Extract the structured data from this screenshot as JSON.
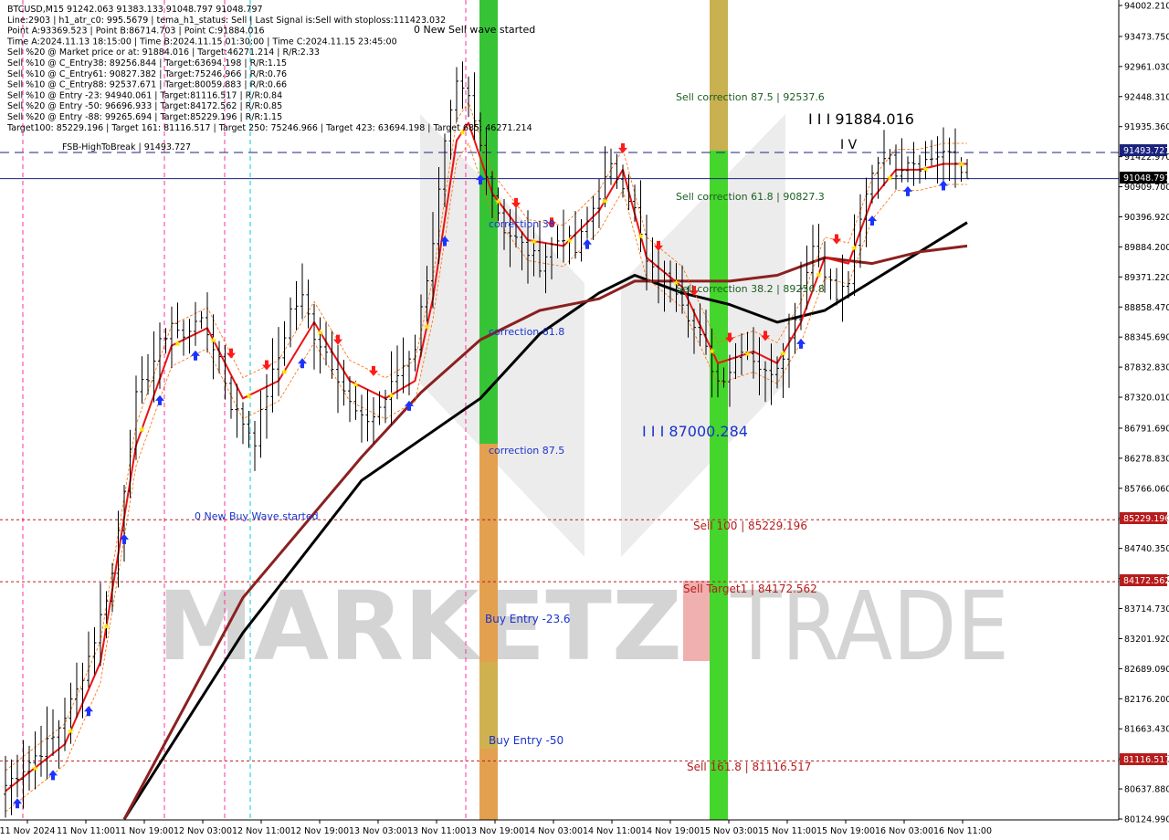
{
  "info_lines": [
    "BTCUSD,M15  91242.063 91383.133 91048.797 91048.797",
    "Line:2903 | h1_atr_c0: 995.5679 | tema_h1_status: Sell | Last Signal is:Sell with stoploss:111423.032",
    "Point A:93369.523 | Point B:86714.703 | Point C:91884.016",
    "Time A:2024.11.13 18:15:00 | Time B:2024.11.15 01:30:00 | Time C:2024.11.15 23:45:00",
    "Sell %20 @ Market price or at: 91884.016 | Target:46271.214 | R/R:2.33",
    "Sell %10 @ C_Entry38: 89256.844 | Target:63694.198 | R/R:1.15",
    "Sell %10 @ C_Entry61: 90827.382 | Target:75246.966 | R/R:0.76",
    "Sell %10 @ C_Entry88: 92537.671 | Target:80059.883 | R/R:0.66",
    "Sell %10 @ Entry -23: 94940.061 | Target:81116.517 | R/R:0.84",
    "Sell %20 @ Entry -50: 96696.933 | Target:84172.562 | R/R:0.85",
    "Sell %20 @ Entry -88: 99265.694 | Target:85229.196 | R/R:1.15",
    "Target100: 85229.196 | Target 161: 81116.517 | Target 250: 75246.966 | Target 423: 63694.198 | Target 685: 46271.214"
  ],
  "watermark": {
    "left": "MARKETZ",
    "right": "TRADE"
  },
  "annotations": {
    "sell_wave": "0 New Sell wave started",
    "buy_wave": "0 New Buy Wave started",
    "fsb": "FSB-HighToBreak | 91493.727",
    "point_c": "I I I 91884.016",
    "point_c_mark": "I V",
    "point_b": "I I I 87000.284",
    "corr_38": "correction 38",
    "corr_61": "correction 61.8",
    "corr_87": "correction 87.5",
    "buy_entry_23": "Buy Entry -23.6",
    "buy_entry_50": "Buy Entry -50",
    "sell_corr_87": "Sell correction 87.5 | 92537.6",
    "sell_corr_61": "Sell correction 61.8 | 90827.3",
    "sell_corr_38": "Sell correction 38.2 | 89256.8",
    "sell_100": "Sell 100 | 85229.196",
    "sell_target1": "Sell Target1 | 84172.562",
    "sell_161": "Sell 161.8 | 81116.517"
  },
  "level_badges": {
    "fsb": "91493.727",
    "current": "91048.797",
    "sell_100": "85229.196",
    "sell_target1": "84172.562",
    "sell_161": "81116.517"
  },
  "colors": {
    "background": "#ffffff",
    "candle": "#000000",
    "ema_fast": "#ee1111",
    "ema_mid": "#8b2020",
    "ema_slow": "#000000",
    "blue_level": "#1a237e",
    "red_level": "#b71c1c",
    "green_zone": "#33cc33",
    "orange_zone": "#e8a050",
    "pink_vline": "#ff3399",
    "cyan_vline": "#00cccc",
    "buy_arrow": "#1a33ff",
    "sell_arrow": "#ff1a1a",
    "star": "#f5e400"
  },
  "chart_data": {
    "type": "candlestick",
    "symbol": "BTCUSD",
    "timeframe": "M15",
    "ohlc_last": {
      "open": 91242.063,
      "high": 91383.133,
      "low": 91048.797,
      "close": 91048.797
    },
    "ylim": [
      80124.99,
      94002.21
    ],
    "y_ticks": [
      94002.21,
      93473.75,
      92961.03,
      92448.31,
      91935.36,
      91422.97,
      90909.7,
      90396.92,
      89884.2,
      89371.22,
      88858.47,
      88345.69,
      87832.83,
      87320.01,
      86791.69,
      86278.83,
      85766.06,
      85253.12,
      84740.35,
      84227.28,
      83714.73,
      83201.92,
      82689.09,
      82176.2,
      81663.43,
      81150.51,
      80637.88,
      80124.99
    ],
    "y_tick_labels": [
      "94002.210",
      "93473.750",
      "92961.030",
      "92448.310",
      "91935.360",
      "91422.970",
      "90909.700",
      "90396.920",
      "89884.200",
      "89371.220",
      "88858.470",
      "88345.690",
      "87832.830",
      "87320.010",
      "86791.690",
      "86278.830",
      "85766.060",
      "85253.120",
      "84740.350",
      "84227.280",
      "83714.730",
      "83201.920",
      "82689.090",
      "82176.200",
      "81663.430",
      "81150.510",
      "80637.880",
      "80124.990"
    ],
    "x_tick_labels": [
      "11 Nov 2024",
      "11 Nov 11:00",
      "11 Nov 19:00",
      "12 Nov 03:00",
      "12 Nov 11:00",
      "12 Nov 19:00",
      "13 Nov 03:00",
      "13 Nov 11:00",
      "13 Nov 19:00",
      "14 Nov 03:00",
      "14 Nov 11:00",
      "14 Nov 19:00",
      "15 Nov 03:00",
      "15 Nov 11:00",
      "15 Nov 19:00",
      "16 Nov 03:00",
      "16 Nov 11:00"
    ],
    "levels": [
      {
        "name": "FSB-HighToBreak",
        "value": 91493.727,
        "style": "dashed"
      },
      {
        "name": "current",
        "value": 91048.797,
        "style": "solid"
      },
      {
        "name": "Sell 100",
        "value": 85229.196,
        "style": "dotted"
      },
      {
        "name": "Sell Target1",
        "value": 84172.562,
        "style": "dotted"
      },
      {
        "name": "Sell 161.8",
        "value": 81116.517,
        "style": "dotted"
      }
    ],
    "close_path": [
      [
        0,
        80700
      ],
      [
        4,
        81100
      ],
      [
        8,
        81500
      ],
      [
        12,
        82300
      ],
      [
        15,
        83200
      ],
      [
        18,
        84300
      ],
      [
        20,
        85800
      ],
      [
        22,
        87300
      ],
      [
        24,
        87700
      ],
      [
        26,
        88200
      ],
      [
        28,
        88600
      ],
      [
        30,
        88300
      ],
      [
        32,
        88700
      ],
      [
        34,
        88400
      ],
      [
        36,
        88000
      ],
      [
        38,
        87200
      ],
      [
        40,
        86900
      ],
      [
        42,
        86600
      ],
      [
        44,
        87400
      ],
      [
        46,
        88000
      ],
      [
        48,
        88800
      ],
      [
        50,
        89000
      ],
      [
        52,
        88400
      ],
      [
        54,
        88100
      ],
      [
        56,
        87700
      ],
      [
        58,
        87200
      ],
      [
        60,
        86900
      ],
      [
        62,
        87000
      ],
      [
        64,
        87300
      ],
      [
        66,
        87700
      ],
      [
        69,
        88200
      ],
      [
        72,
        90000
      ],
      [
        74,
        91600
      ],
      [
        76,
        92600
      ],
      [
        78,
        92400
      ],
      [
        80,
        91600
      ],
      [
        82,
        90800
      ],
      [
        84,
        90200
      ],
      [
        86,
        90000
      ],
      [
        88,
        89800
      ],
      [
        90,
        89600
      ],
      [
        92,
        89900
      ],
      [
        94,
        90100
      ],
      [
        96,
        89800
      ],
      [
        98,
        90300
      ],
      [
        100,
        90800
      ],
      [
        102,
        91200
      ],
      [
        104,
        91000
      ],
      [
        106,
        90500
      ],
      [
        108,
        89600
      ],
      [
        110,
        89300
      ],
      [
        112,
        89400
      ],
      [
        114,
        89000
      ],
      [
        116,
        88500
      ],
      [
        118,
        88100
      ],
      [
        120,
        87600
      ],
      [
        122,
        87800
      ],
      [
        124,
        88200
      ],
      [
        126,
        88000
      ],
      [
        128,
        87700
      ],
      [
        130,
        87900
      ],
      [
        132,
        88300
      ],
      [
        134,
        89200
      ],
      [
        136,
        89900
      ],
      [
        138,
        89500
      ],
      [
        140,
        89000
      ],
      [
        142,
        89300
      ],
      [
        144,
        90300
      ],
      [
        146,
        91200
      ],
      [
        148,
        91500
      ],
      [
        150,
        91200
      ],
      [
        152,
        91400
      ],
      [
        154,
        91300
      ],
      [
        156,
        91400
      ],
      [
        158,
        91500
      ],
      [
        160,
        91300
      ],
      [
        162,
        91048.797
      ]
    ],
    "ema_fast": [
      [
        0,
        80600
      ],
      [
        10,
        81400
      ],
      [
        16,
        82800
      ],
      [
        22,
        86500
      ],
      [
        28,
        88200
      ],
      [
        34,
        88500
      ],
      [
        40,
        87300
      ],
      [
        46,
        87600
      ],
      [
        52,
        88600
      ],
      [
        58,
        87600
      ],
      [
        64,
        87300
      ],
      [
        69,
        87600
      ],
      [
        72,
        89000
      ],
      [
        76,
        91700
      ],
      [
        78,
        92000
      ],
      [
        82,
        90800
      ],
      [
        88,
        90000
      ],
      [
        94,
        89900
      ],
      [
        100,
        90500
      ],
      [
        104,
        91200
      ],
      [
        108,
        89700
      ],
      [
        114,
        89200
      ],
      [
        120,
        87900
      ],
      [
        126,
        88100
      ],
      [
        130,
        87900
      ],
      [
        134,
        88600
      ],
      [
        138,
        89700
      ],
      [
        142,
        89600
      ],
      [
        146,
        90700
      ],
      [
        150,
        91200
      ],
      [
        154,
        91200
      ],
      [
        158,
        91300
      ],
      [
        162,
        91300
      ]
    ],
    "ema_mid": [
      [
        20,
        80120
      ],
      [
        40,
        83900
      ],
      [
        60,
        86300
      ],
      [
        70,
        87400
      ],
      [
        80,
        88300
      ],
      [
        90,
        88800
      ],
      [
        100,
        89000
      ],
      [
        106,
        89300
      ],
      [
        114,
        89300
      ],
      [
        122,
        89300
      ],
      [
        130,
        89400
      ],
      [
        138,
        89700
      ],
      [
        146,
        89600
      ],
      [
        154,
        89800
      ],
      [
        162,
        89900
      ]
    ],
    "ema_slow": [
      [
        20,
        80120
      ],
      [
        40,
        83300
      ],
      [
        60,
        85900
      ],
      [
        70,
        86600
      ],
      [
        80,
        87300
      ],
      [
        90,
        88400
      ],
      [
        100,
        89100
      ],
      [
        106,
        89400
      ],
      [
        114,
        89100
      ],
      [
        122,
        88900
      ],
      [
        130,
        88600
      ],
      [
        138,
        88800
      ],
      [
        146,
        89300
      ],
      [
        154,
        89800
      ],
      [
        162,
        90300
      ]
    ]
  }
}
